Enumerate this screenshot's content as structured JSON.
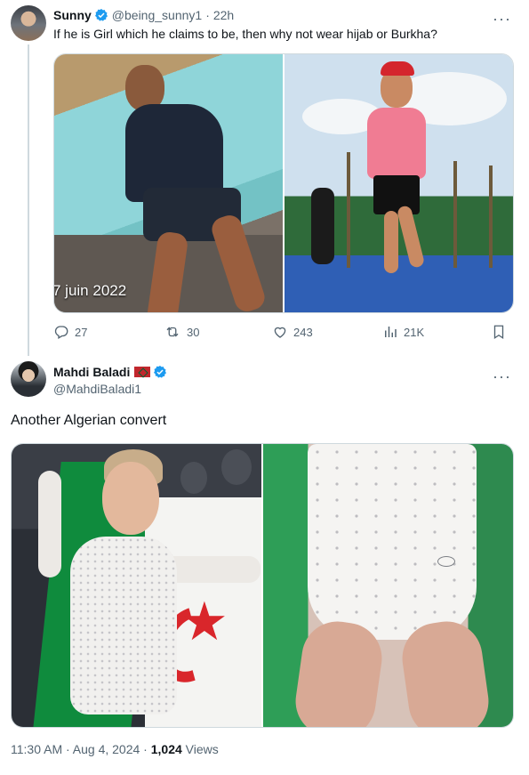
{
  "parent_tweet": {
    "author_name": "Sunny",
    "handle": "@being_sunny1",
    "separator": "·",
    "time": "22h",
    "text": "If he is Girl which he claims to be, then why not wear hijab or Burkha?",
    "more": "···",
    "photo_overlay_text": "7 juin 2022",
    "actions": {
      "replies": "27",
      "reposts": "30",
      "likes": "243",
      "views": "21K"
    }
  },
  "main_tweet": {
    "author_name": "Mahdi Baladi",
    "handle": "@MahdiBaladi1",
    "more": "···",
    "text": "Another Algerian convert",
    "timestamp": "11:30 AM · Aug 4, 2024 · ",
    "views_count": "1,024",
    "views_label": " Views"
  },
  "colors": {
    "verified_blue": "#1d9bf0",
    "text_primary": "#0f1419",
    "text_secondary": "#536471",
    "border": "#cfd9de"
  },
  "icons": {
    "verified": "verified-badge-icon",
    "reply": "reply-icon",
    "repost": "repost-icon",
    "like": "heart-icon",
    "views": "analytics-icon",
    "bookmark": "bookmark-icon",
    "more": "more-icon"
  }
}
